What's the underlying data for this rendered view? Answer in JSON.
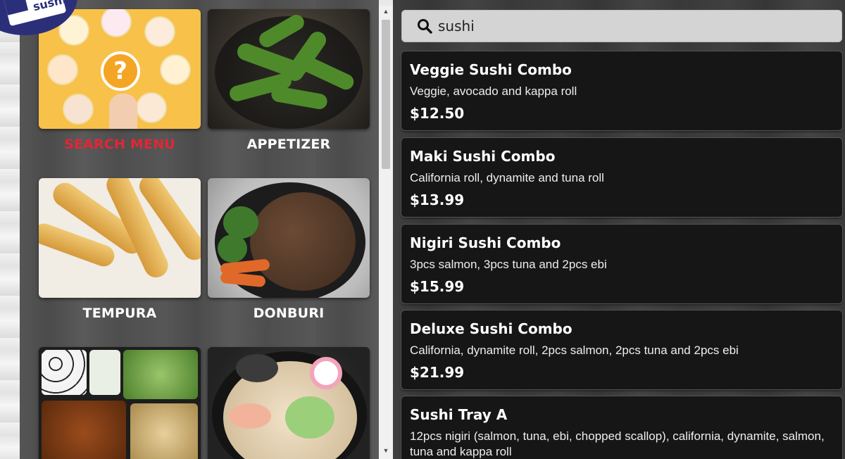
{
  "logo": {
    "text": "sushi"
  },
  "categories": [
    {
      "label": "SEARCH MENU",
      "active": true,
      "image": "search-menu-illustration"
    },
    {
      "label": "APPETIZER",
      "active": false,
      "image": "edamame-photo"
    },
    {
      "label": "TEMPURA",
      "active": false,
      "image": "tempura-photo"
    },
    {
      "label": "DONBURI",
      "active": false,
      "image": "donburi-photo"
    },
    {
      "label": "",
      "active": false,
      "image": "bento-photo"
    },
    {
      "label": "",
      "active": false,
      "image": "udon-photo"
    }
  ],
  "search": {
    "value": "sushi",
    "icon": "search-icon"
  },
  "results": [
    {
      "title": "Veggie Sushi Combo",
      "description": "Veggie, avocado and kappa roll",
      "price": "$12.50"
    },
    {
      "title": "Maki Sushi Combo",
      "description": "California roll, dynamite and tuna roll",
      "price": "$13.99"
    },
    {
      "title": "Nigiri Sushi Combo",
      "description": "3pcs salmon, 3pcs tuna and 2pcs ebi",
      "price": "$15.99"
    },
    {
      "title": "Deluxe Sushi Combo",
      "description": "California, dynamite roll, 2pcs salmon, 2pcs tuna and 2pcs ebi",
      "price": "$21.99"
    },
    {
      "title": "Sushi Tray A",
      "description": "12pcs nigiri (salmon, tuna, ebi, chopped scallop), california, dynamite, salmon, tuna and kappa roll",
      "price": ""
    }
  ],
  "colors": {
    "active_label": "#e32634",
    "card_bg": "#161616",
    "search_bg": "#d4d4d4"
  }
}
